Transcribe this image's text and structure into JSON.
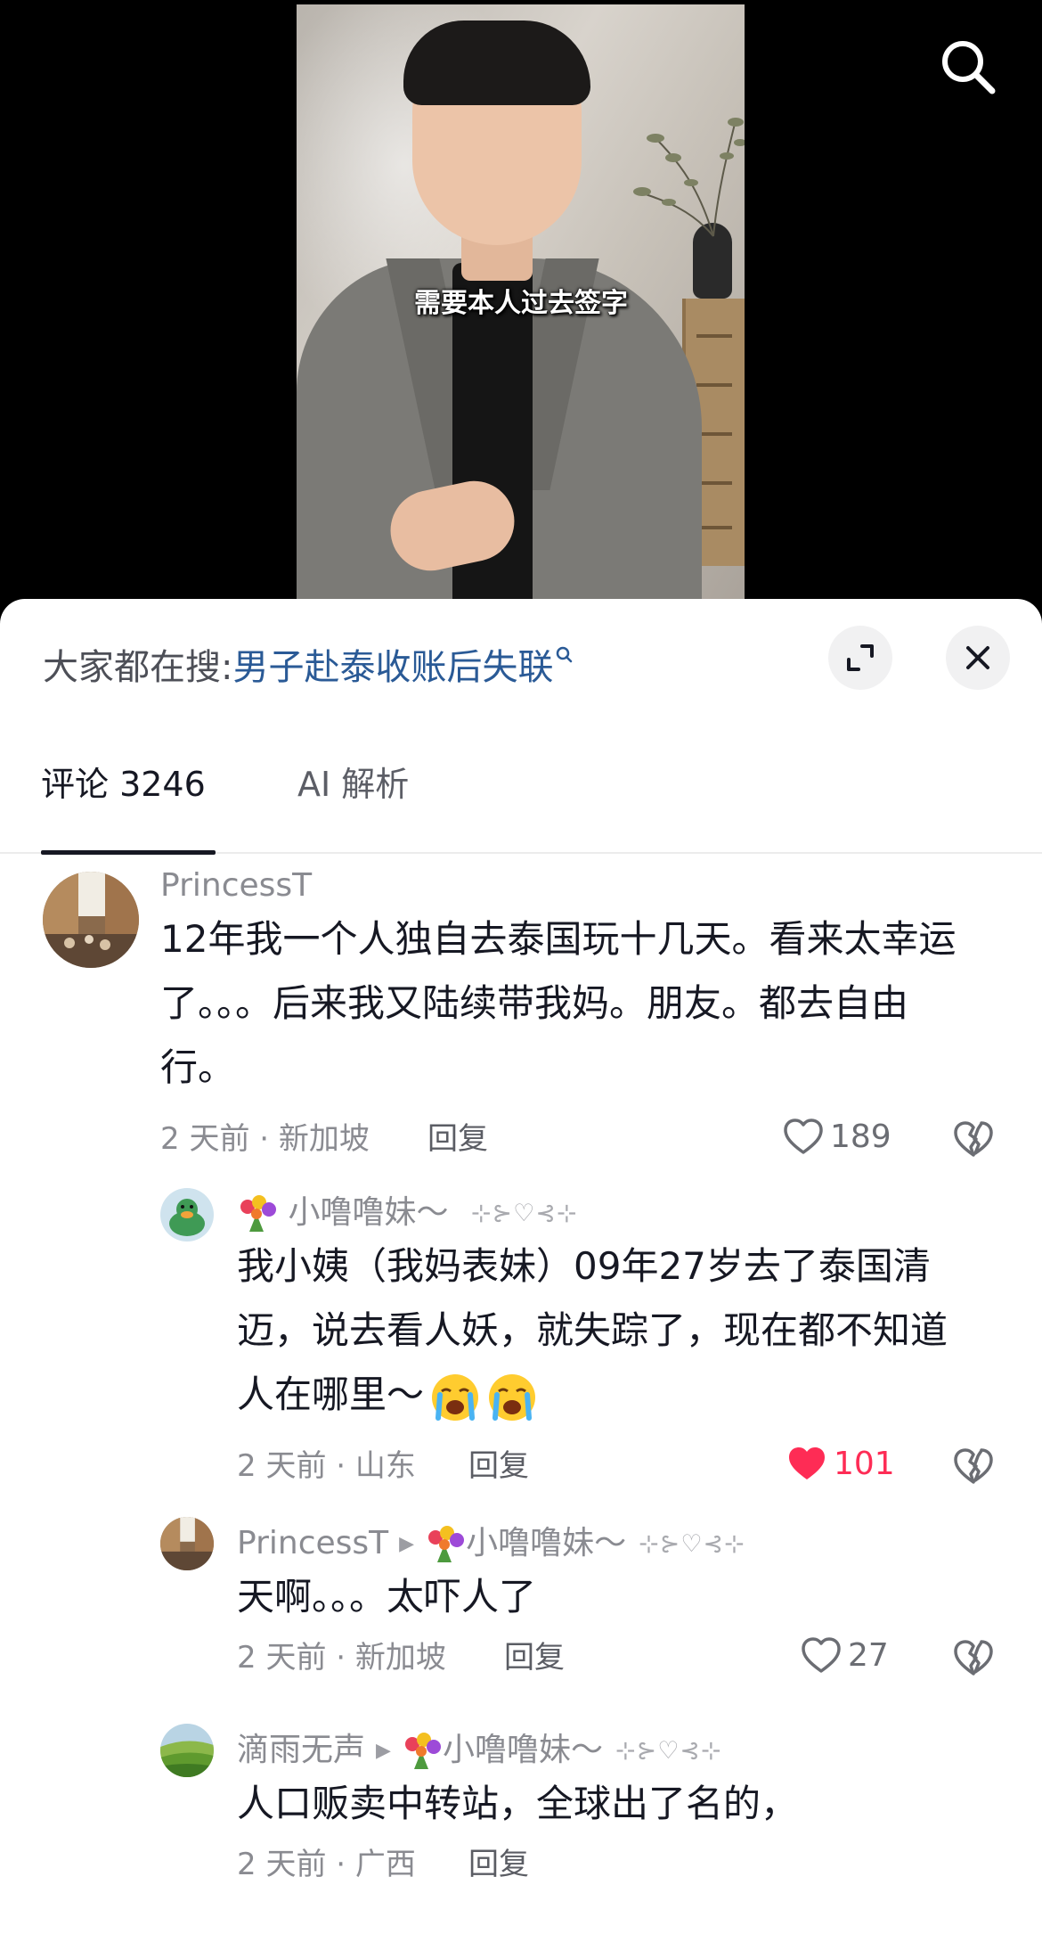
{
  "video": {
    "caption": "需要本人过去签字"
  },
  "trending": {
    "label": "大家都在搜:",
    "query": "男子赴泰收账后失联"
  },
  "tabs": [
    {
      "label": "评论 3246",
      "active": true
    },
    {
      "label": "AI 解析",
      "active": false
    }
  ],
  "comments": [
    {
      "user": "PrincessT",
      "text_lines": [
        "12年我一个人独自去泰国玩十几天。看来太幸运",
        "了。。。后来我又陆续带我妈。朋友。都去自由",
        "行。"
      ],
      "meta": "2 天前 · 新加坡",
      "reply_label": "回复",
      "likes": "189",
      "liked": false
    },
    {
      "user": "小噜噜妹～",
      "user_decor": "⊹⊱♡⊰⊹",
      "text_lines": [
        "我小姨（我妈表妹）09年27岁去了泰国清",
        "迈，说去看人妖，就失踪了，现在都不知道",
        "人在哪里～"
      ],
      "meta": "2 天前 · 山东",
      "reply_label": "回复",
      "likes": "101",
      "liked": true
    },
    {
      "user": "PrincessT",
      "reply_to": "小噜噜妹～",
      "user_decor": "⊹⊱♡⊰⊹",
      "text_lines": [
        "天啊。。。太吓人了"
      ],
      "meta": "2 天前 · 新加坡",
      "reply_label": "回复",
      "likes": "27",
      "liked": false
    },
    {
      "user": "滴雨无声",
      "reply_to": "小噜噜妹～",
      "user_decor": "⊹⊱♡⊰⊹",
      "text_lines": [
        "人口贩卖中转站，全球出了名的，"
      ],
      "meta": "2 天前 · 广西",
      "reply_label": "回复"
    }
  ],
  "colors": {
    "like_active": "#fe2c55",
    "link_blue": "#2a5a96",
    "muted": "#8a8b91"
  },
  "icons": [
    "search-icon",
    "expand-icon",
    "close-icon",
    "heart-icon",
    "broken-heart-icon",
    "crying-emoji-icon",
    "flower-bouquet-icon"
  ]
}
